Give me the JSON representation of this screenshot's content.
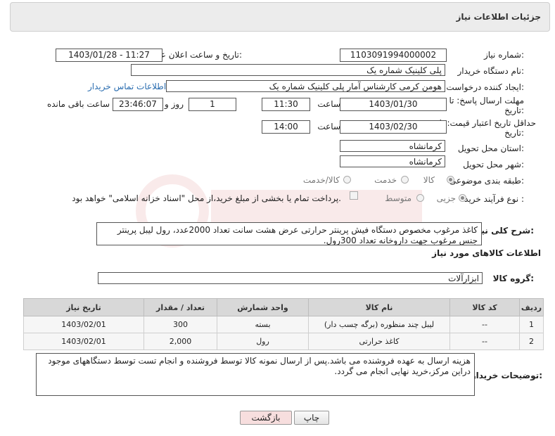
{
  "header": {
    "title": "جزئیات اطلاعات نیاز"
  },
  "form": {
    "need_number_label": "شماره نیاز:",
    "need_number": "1103091994000002",
    "announce_label": "تاریخ و ساعت اعلان عمومی:",
    "announce_value": "1403/01/28 - 11:27",
    "buyer_org_label": "نام دستگاه خریدار:",
    "buyer_org": "پلی کلینیک شماره یک",
    "requester_label": "ایجاد کننده درخواست:",
    "requester": "هومن کرمی کارشناس آمار پلی کلینیک شماره یک",
    "contact_link": "اطلاعات تماس خریدار",
    "deadline_label_1": "مهلت ارسال پاسخ: تا",
    "deadline_label_2": "تاریخ:",
    "deadline_date": "1403/01/30",
    "time_label": "ساعت",
    "deadline_time": "11:30",
    "days_value": "1",
    "days_label": "روز و",
    "remaining_time": "23:46:07",
    "remaining_label": "ساعت باقی مانده",
    "min_validity_label_1": "حداقل تاریخ اعتبار قیمت: تا",
    "min_validity_label_2": "تاریخ:",
    "validity_date": "1403/02/30",
    "validity_time": "14:00",
    "province_label": "استان محل تحویل:",
    "province": "کرمانشاه",
    "city_label": "شهر محل تحویل:",
    "city": "کرمانشاه",
    "category_label": "طبقه بندی موضوعی:",
    "category_options": [
      "کالا",
      "خدمت",
      "کالا/خدمت"
    ],
    "purchase_type_label": "نوع فرآیند خرید :",
    "purchase_options": [
      "جزیی",
      "متوسط"
    ],
    "payment_note": "پرداخت تمام یا بخشی از مبلغ خرید،از محل \"اسناد خزانه اسلامی\" خواهد بود."
  },
  "summary": {
    "label": "شرح کلی نیاز:",
    "text": "کاغذ مرغوب مخصوص دستگاه فیش پرینتر حرارتی عرض هشت سانت تعداد 2000عدد، رول لیبل پرینتر جنس مرغوب جهت داروخانه تعداد 300رول."
  },
  "goods": {
    "section_title": "اطلاعات کالاهای مورد نیاز",
    "group_label": "گروه کالا:",
    "group_value": "ابزارآلات",
    "columns": [
      "ردیف",
      "کد کالا",
      "نام کالا",
      "واحد شمارش",
      "تعداد / مقدار",
      "تاریخ نیاز"
    ],
    "rows": [
      [
        "1",
        "--",
        "لیبل چند منظوره (برگه چسب دار)",
        "بسته",
        "300",
        "1403/02/01"
      ],
      [
        "2",
        "--",
        "کاغذ حرارتی",
        "رول",
        "2,000",
        "1403/02/01"
      ]
    ]
  },
  "buyer_notes": {
    "label": "توضیحات خریدار:",
    "text": "هزینه ارسال به عهده فروشنده می باشد.پس از ارسال نمونه کالا توسط فروشنده و انجام تست توسط دستگاههای موجود دراین مرکز،خرید نهایی انجام می گردد."
  },
  "buttons": {
    "print": "چاپ",
    "back": "بازگشت"
  },
  "colors": {
    "link": "#2a6db0",
    "back_button_bg": "#f7dede",
    "header_bg": "#ececec"
  }
}
